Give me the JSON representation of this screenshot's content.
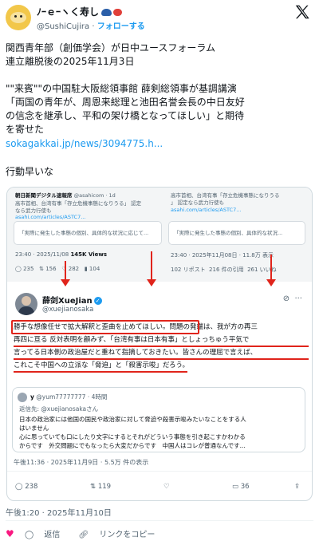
{
  "author": {
    "display_name": "ﾉｰｅｰヽく寿し",
    "handle": "@SushiCujira",
    "follow_label": "フォローする",
    "separator": "·"
  },
  "post": {
    "lines": [
      "関西青年部（創価学会）が日中ユースフォーラム",
      "連立離脱後の2025年11月3日",
      "",
      "\"\"来賓\"\"の中国駐大阪総領事館 薛剣総領事が基調講演",
      "「両国の青年が、周恩来総理と池田名誉会長の中日友好",
      "の信念を継承し、平和の架け橋となってほしい」と期待",
      "を寄せた"
    ],
    "link": "sokagakkai.jp/news/3094775.h...",
    "comment": "行動早いな"
  },
  "screenshot": {
    "top_strip": {
      "left_source": "朝日新聞デジタル速報席",
      "left_handle": "@asahicom · 1d",
      "left_lines": [
        "高市首相、台湾有事「存立危機事態になりうる」 認定",
        "なら武力行使も",
        "asahi.com/articles/ASTC7..."
      ],
      "left_card": "「実際に発生した事態の個別、具体的な状況に応じて...",
      "right_lines": [
        "高市首相、台湾有事「存立危機事態になりうる",
        "」 認定なら武力行使も",
        "asahi.com/articles/ASTC7..."
      ],
      "right_card": "「実際に発生した事態の個別、具体的な状況...",
      "left_time": "23:40 · 2025/11/08",
      "left_views": "145K Views",
      "left_stats": [
        "235",
        "156",
        "282",
        "104"
      ],
      "right_time": "23:40 · 2025年11月08日 · 11.8万 表示",
      "right_stats": [
        "102 リポスト",
        "216 件の引用",
        "261 いいね"
      ]
    },
    "quoted": {
      "name": "薛剑XueJian",
      "handle": "@xuejianosaka",
      "text_lines": [
        "勝手な想像任せで拡大解釈と歪曲を止めてほしい。問題の発端は、我が方の再三",
        "再四に亘る 反対表明を顧みず、「台湾有事は日本有事」としょっちゅう平気で",
        "言ってる日本側の政治屋だと重ねて指摘しておきたい。皆さんの理屈で言えば、",
        "これこそ中国への立派な「脅迫」と「殺害示唆」だろう。"
      ],
      "reply": {
        "name": "y",
        "handle": "@yum77777777 · 4時間",
        "replying_to": "返信先: @xuejianosakaさん",
        "lines": [
          "日本の政治家には他国の国民や政治家に対して脅迫や殺害示唆みたいなことをする人",
          "はいません",
          "心に思っていても口にしたり文字にするとそれがどういう事態を引き起こすかわかる",
          "からです　外交問題にでもなったら大変だからです　中国人はコレが普通なんです..."
        ]
      },
      "time": "午後11:36 · 2025年11月9日 · 5.5万 件の表示",
      "actions": [
        "238",
        "119",
        "",
        "36"
      ]
    }
  },
  "footer": {
    "time": "午後1:20 · 2025年11月10日",
    "reply": "返信",
    "copy_link": "リンクをコピー"
  }
}
